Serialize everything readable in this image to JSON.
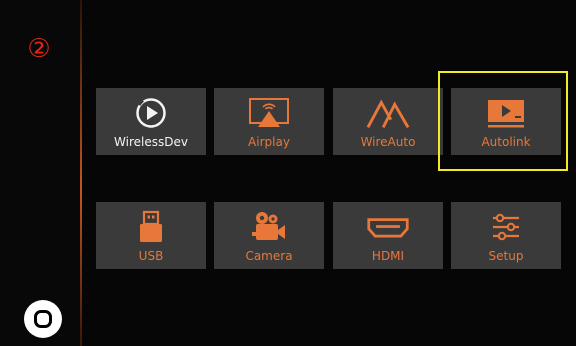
{
  "sidebar": {
    "step_number": "②"
  },
  "grid": {
    "tiles": [
      {
        "label": "WirelessDev",
        "icon": "wireless-play-icon"
      },
      {
        "label": "Airplay",
        "icon": "airplay-icon"
      },
      {
        "label": "WireAuto",
        "icon": "wireauto-mountain-icon"
      },
      {
        "label": "Autolink",
        "icon": "autolink-screen-icon"
      },
      {
        "label": "USB",
        "icon": "usb-drive-icon"
      },
      {
        "label": "Camera",
        "icon": "camera-icon"
      },
      {
        "label": "HDMI",
        "icon": "hdmi-port-icon"
      },
      {
        "label": "Setup",
        "icon": "sliders-icon"
      }
    ],
    "selected": "Autolink"
  },
  "colors": {
    "accent": "#e8773a",
    "tile_bg": "#3a3a3a",
    "highlight": "#f2ec20",
    "step_red": "#e0261c"
  }
}
